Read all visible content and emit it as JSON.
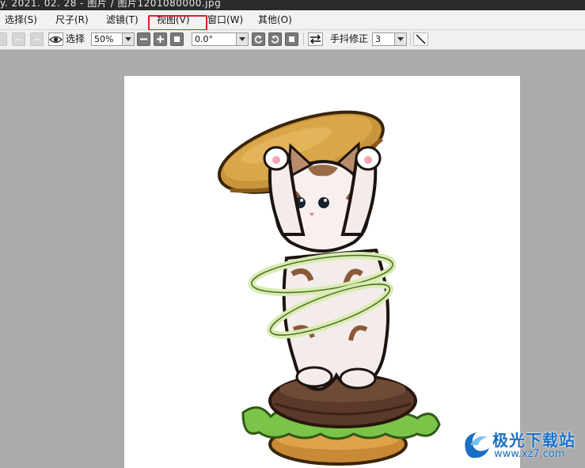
{
  "title_bar": {
    "text": "y. 2021. 02. 28 - 图片 / 图片1201080000.jpg"
  },
  "menu": {
    "items": [
      {
        "label": "选择(S)"
      },
      {
        "label": "尺子(R)"
      },
      {
        "label": "滤镜(T)"
      },
      {
        "label": "视图(V)"
      },
      {
        "label": "窗口(W)"
      },
      {
        "label": "其他(O)"
      }
    ],
    "highlighted": "视图(V)",
    "highlight_color": "#e02020"
  },
  "toolbar": {
    "select_label": "选择",
    "zoom_value": "50%",
    "rotation_value": "0.0°",
    "stabilizer_label": "手抖修正",
    "stabilizer_value": "3",
    "icons": [
      "undo-icon",
      "redo-icon",
      "eye-icon",
      "zoom-out-icon",
      "zoom-in-icon",
      "fit-icon",
      "rotate-left-icon",
      "rotate-right-icon",
      "reset-rotation-icon",
      "flip-icon",
      "line-icon"
    ]
  },
  "canvas": {
    "background": "#ffffff",
    "artwork": "cat-burger-illustration"
  },
  "watermark": {
    "name": "极光下载站",
    "url": "www.xz7.com",
    "color": "#1a6fc4"
  }
}
